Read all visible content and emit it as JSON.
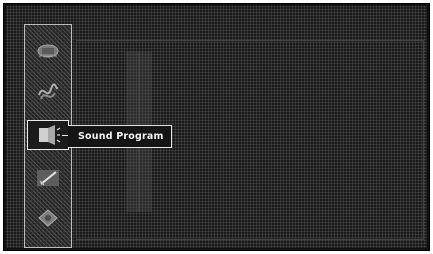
{
  "menu": {
    "items": [
      {
        "icon": "picture-icon"
      },
      {
        "icon": "audio-waves-icon"
      },
      {
        "icon": "sound-program-icon",
        "label": "Sound Program",
        "selected": true
      },
      {
        "icon": "setup-icon"
      },
      {
        "icon": "options-icon"
      }
    ]
  }
}
